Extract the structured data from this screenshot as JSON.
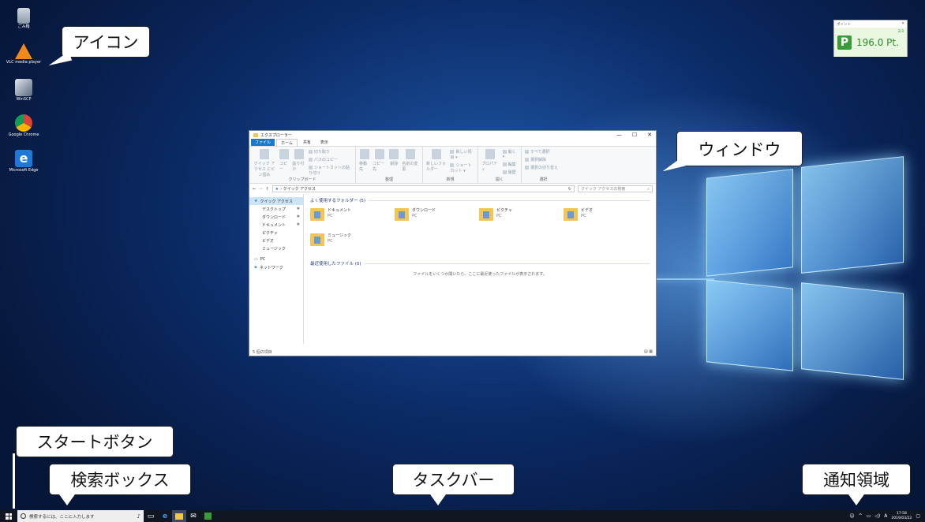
{
  "callouts": {
    "icon": "アイコン",
    "window": "ウィンドウ",
    "start_button": "スタートボタン",
    "search_box": "検索ボックス",
    "taskbar": "タスクバー",
    "notification_area": "通知領域"
  },
  "desktop_icons": [
    {
      "label": "ごみ箱",
      "icon": "recycle-bin-icon"
    },
    {
      "label": "VLC media player",
      "icon": "vlc-icon"
    },
    {
      "label": "WinSCP",
      "icon": "winscp-icon"
    },
    {
      "label": "Google Chrome",
      "icon": "chrome-icon"
    },
    {
      "label": "Microsoft Edge",
      "icon": "edge-icon"
    }
  ],
  "explorer": {
    "title": "エクスプローラー",
    "tabs": [
      "ファイル",
      "ホーム",
      "共有",
      "表示"
    ],
    "ribbon": {
      "clipboard": {
        "name": "クリップボード",
        "pin": "クイック アクセス にピン留め",
        "copy": "コピー",
        "paste": "貼り付け",
        "cut": "切り取り",
        "copy_path": "パスのコピー",
        "paste_shortcut": "ショートカットの貼り付け"
      },
      "organize": {
        "name": "整理",
        "move": "移動先",
        "copy_to": "コピー先",
        "delete": "削除",
        "rename": "名前の変更"
      },
      "new": {
        "name": "新規",
        "new_folder": "新しいフォルダー",
        "new_item": "新しい項目 ▾",
        "shortcut": "ショートカット ▾"
      },
      "open": {
        "name": "開く",
        "properties": "プロパティ",
        "open": "開く ▾",
        "edit": "編集",
        "history": "履歴"
      },
      "select": {
        "name": "選択",
        "all": "すべて選択",
        "none": "選択解除",
        "invert": "選択の切り替え"
      }
    },
    "address": "› クイック アクセス",
    "search_placeholder": "クイック アクセスの検索",
    "nav": {
      "quick_access": "クイック アクセス",
      "items": [
        "デスクトップ",
        "ダウンロード",
        "ドキュメント",
        "ピクチャ",
        "ビデオ",
        "ミュージック"
      ],
      "pc": "PC",
      "network": "ネットワーク"
    },
    "frequent_header": "よく使用するフォルダー (5)",
    "folders": [
      {
        "name": "ドキュメント",
        "sub": "PC"
      },
      {
        "name": "ダウンロード",
        "sub": "PC"
      },
      {
        "name": "ピクチャ",
        "sub": "PC"
      },
      {
        "name": "ビデオ",
        "sub": "PC"
      },
      {
        "name": "ミュージック",
        "sub": "PC"
      }
    ],
    "recent_header": "最近使用したファイル (0)",
    "recent_empty": "ファイルをいくつか開いたら、ここに最近使ったファイルが表示されます。",
    "status": "5 個の項目",
    "window_controls": [
      "—",
      "☐",
      "✕"
    ]
  },
  "gadget": {
    "title": "ポイント",
    "level": "2/3",
    "points": "196.0 Pt."
  },
  "taskbar": {
    "search_placeholder": "検索するには、ここに入力します",
    "ime": "A",
    "time": "17:58",
    "date": "2019/03/22"
  }
}
